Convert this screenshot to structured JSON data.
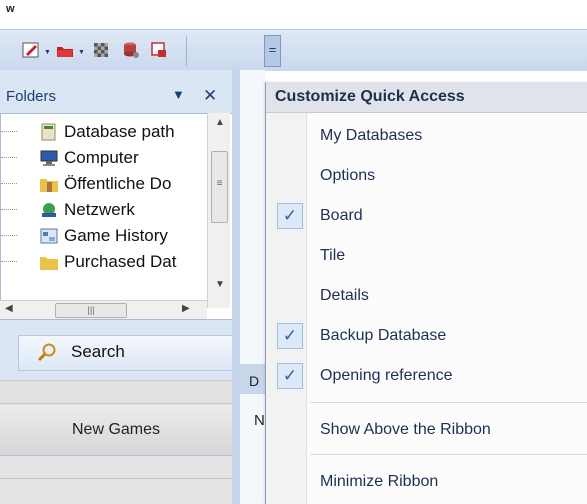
{
  "app": {
    "title_letter": "w"
  },
  "qat": {
    "buttons": [
      {
        "name": "new-icon",
        "color": "#c8202a"
      },
      {
        "name": "open-icon",
        "color": "#c41e1e"
      },
      {
        "name": "board-icon",
        "color": "#777777"
      },
      {
        "name": "database-icon",
        "color": "#b84040"
      },
      {
        "name": "export-icon",
        "color": "#c03030"
      }
    ],
    "customize_symbol": "="
  },
  "folders": {
    "title": "Folders",
    "menu_arrow": "▼",
    "close": "✕",
    "items": [
      {
        "label": "Database path",
        "icon": "database-icon"
      },
      {
        "label": "Computer",
        "icon": "computer-icon"
      },
      {
        "label": "Öffentliche Do",
        "icon": "folder-user-icon"
      },
      {
        "label": "Netzwerk",
        "icon": "network-icon"
      },
      {
        "label": "Game History",
        "icon": "history-icon"
      },
      {
        "label": "Purchased Dat",
        "icon": "folder-icon"
      }
    ],
    "scroll": {
      "up": "▲",
      "down": "▼",
      "left": "◀",
      "right": "▶",
      "grip": "≡",
      "hgrip": "|||"
    }
  },
  "nav": {
    "search_label": "Search",
    "new_games_label": "New Games"
  },
  "main": {
    "tab_partial": "D",
    "column_partial": "N"
  },
  "menu": {
    "title": "Customize Quick Access",
    "check_glyph": "✓",
    "items": [
      {
        "label": "My Databases",
        "checked": false
      },
      {
        "label": "Options",
        "checked": false
      },
      {
        "label": "Board",
        "checked": true
      },
      {
        "label": "Tile",
        "checked": false
      },
      {
        "label": "Details",
        "checked": false
      },
      {
        "label": "Backup Database",
        "checked": true
      },
      {
        "label": "Opening reference",
        "checked": true
      }
    ],
    "ribbon_items": [
      {
        "label": "Show Above the Ribbon"
      },
      {
        "label": "Minimize Ribbon"
      }
    ]
  }
}
